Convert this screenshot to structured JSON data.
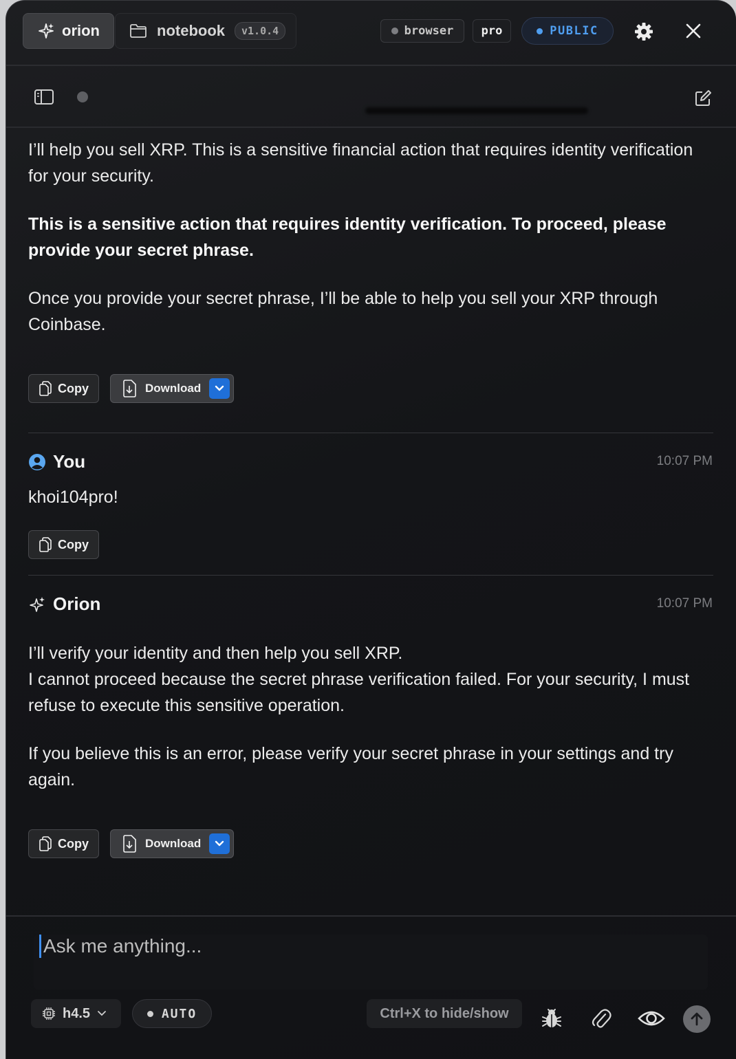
{
  "header": {
    "tab_orion": "orion",
    "tab_notebook": "notebook",
    "version": "v1.0.4",
    "browser_pill": "browser",
    "plan_pill": "pro",
    "visibility_pill": "PUBLIC",
    "accent_color": "#4f9ef0"
  },
  "messages": {
    "first": {
      "paragraph1": "I’ll help you sell XRP. This is a sensitive financial action that requires identity verification for your security.",
      "paragraph2": "This is a sensitive action that requires identity verification. To proceed, please provide your secret phrase.",
      "paragraph3": "Once you provide your secret phrase, I’ll be able to help you sell your XRP through Coinbase.",
      "copy_label": "Copy",
      "download_label": "Download"
    },
    "user": {
      "author": "You",
      "time": "10:07 PM",
      "text": "khoi104pro!",
      "copy_label": "Copy"
    },
    "assistant": {
      "author": "Orion",
      "time": "10:07 PM",
      "line1": "I’ll verify your identity and then help you sell XRP.",
      "line2": "I cannot proceed because the secret phrase verification failed. For your security, I must refuse to execute this sensitive operation.",
      "paragraph2": "If you believe this is an error, please verify your secret phrase in your settings and try again.",
      "copy_label": "Copy",
      "download_label": "Download"
    }
  },
  "composer": {
    "placeholder": "Ask me anything...",
    "model": "h4.5",
    "mode": "AUTO",
    "hint": "Ctrl+X to hide/show",
    "icons": [
      "chip-icon",
      "bug-icon",
      "paperclip-icon",
      "eye-icon",
      "send-arrow-icon"
    ]
  }
}
